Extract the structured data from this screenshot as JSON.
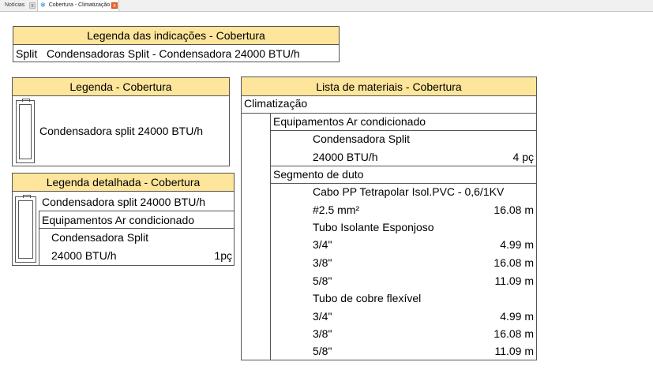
{
  "tabs": [
    {
      "label": "Notícias",
      "close": "x"
    },
    {
      "label": "Cobertura - Climatização",
      "close": "x",
      "icon": "snowflake-icon"
    }
  ],
  "legend_indications": {
    "title": "Legenda das indicações - Cobertura",
    "code": "Split",
    "description": "Condensadoras Split - Condensadora 24000 BTU/h"
  },
  "legend": {
    "title": "Legenda - Cobertura",
    "symbol": "condenser-unit-icon",
    "item": "Condensadora split 24000 BTU/h"
  },
  "legend_detailed": {
    "title": "Legenda detalhada - Cobertura",
    "symbol": "condenser-unit-icon",
    "item": "Condensadora split 24000 BTU/h",
    "group": "Equipamentos Ar condicionado",
    "sub": "Condensadora Split",
    "spec": "24000 BTU/h",
    "qty": "1pç"
  },
  "materials": {
    "title": "Lista de materiais - Cobertura",
    "category": "Climatização",
    "groups": [
      {
        "label": "Equipamentos Ar condicionado",
        "rows": [
          {
            "label": "Condensadora Split",
            "value": ""
          },
          {
            "label": "24000 BTU/h",
            "value": "4 pç"
          }
        ]
      },
      {
        "label": "Segmento de duto",
        "rows": [
          {
            "label": "Cabo PP Tetrapolar Isol.PVC - 0,6/1KV",
            "value": ""
          },
          {
            "label": "#2.5 mm²",
            "value": "16.08 m"
          },
          {
            "label": "Tubo Isolante Esponjoso",
            "value": ""
          },
          {
            "label": "3/4\"",
            "value": "4.99 m"
          },
          {
            "label": "3/8\"",
            "value": "16.08 m"
          },
          {
            "label": "5/8\"",
            "value": "11.09 m"
          },
          {
            "label": "Tubo de cobre flexível",
            "value": ""
          },
          {
            "label": "3/4\"",
            "value": "4.99 m"
          },
          {
            "label": "3/8\"",
            "value": "16.08 m"
          },
          {
            "label": "5/8\"",
            "value": "11.09 m"
          }
        ]
      }
    ]
  },
  "colors": {
    "header_fill": "#fde59b",
    "border": "#555555"
  }
}
